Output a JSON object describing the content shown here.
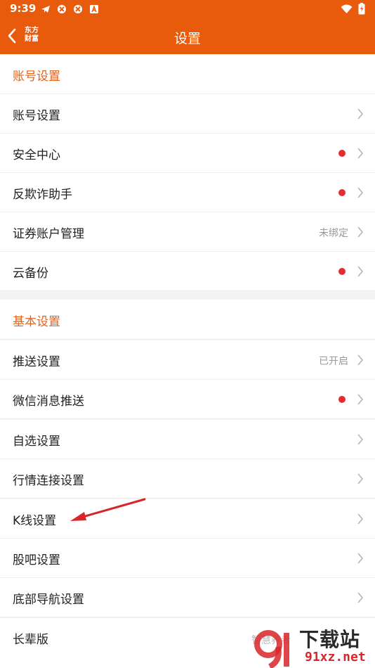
{
  "status_bar": {
    "time": "9:39"
  },
  "nav": {
    "logo_line1": "东方",
    "logo_line2": "财富",
    "title": "设置"
  },
  "sections": [
    {
      "header": "账号设置",
      "rows": [
        {
          "label": "账号设置",
          "value": "",
          "dot": false
        },
        {
          "label": "安全中心",
          "value": "",
          "dot": true
        },
        {
          "label": "反欺诈助手",
          "value": "",
          "dot": true
        },
        {
          "label": "证券账户管理",
          "value": "未绑定",
          "dot": false
        },
        {
          "label": "云备份",
          "value": "",
          "dot": true
        }
      ]
    },
    {
      "header": "基本设置",
      "rows": [
        {
          "label": "推送设置",
          "value": "已开启",
          "dot": false
        },
        {
          "label": "微信消息推送",
          "value": "",
          "dot": true
        },
        {
          "label": "自选设置",
          "value": "",
          "dot": false
        },
        {
          "label": "行情连接设置",
          "value": "",
          "dot": false
        },
        {
          "label": "K线设置",
          "value": "",
          "dot": false
        },
        {
          "label": "股吧设置",
          "value": "",
          "dot": false
        },
        {
          "label": "底部导航设置",
          "value": "",
          "dot": false
        },
        {
          "label": "长辈版",
          "value": "智慧养者",
          "dot": false
        }
      ]
    }
  ],
  "watermark": {
    "cn": "下载站",
    "url": "91xz.net"
  },
  "colors": {
    "brand": "#e95b0c",
    "section_text": "#e2621a",
    "red_dot": "#e52d2d",
    "annotation_arrow": "#d8262a"
  }
}
